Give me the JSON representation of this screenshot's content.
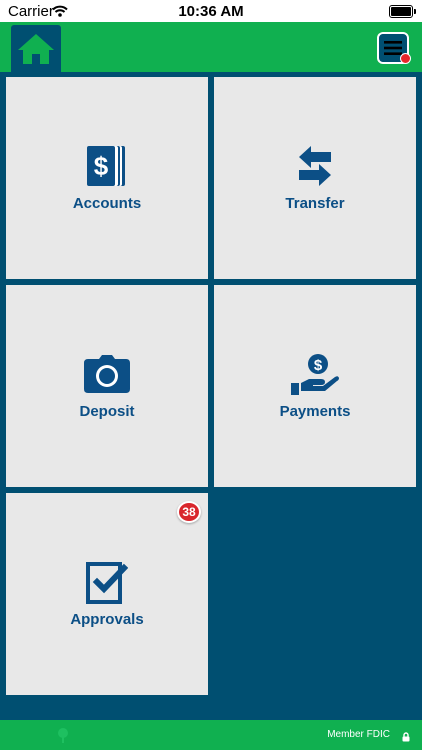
{
  "status_bar": {
    "carrier": "Carrier",
    "time": "10:36 AM"
  },
  "header": {
    "home_icon": "home-icon",
    "menu_icon": "hamburger-menu-icon"
  },
  "tiles": [
    {
      "label": "Accounts",
      "icon": "dollar-cards-icon"
    },
    {
      "label": "Transfer",
      "icon": "transfer-arrows-icon"
    },
    {
      "label": "Deposit",
      "icon": "camera-icon"
    },
    {
      "label": "Payments",
      "icon": "hand-dollar-icon"
    },
    {
      "label": "Approvals",
      "icon": "checkbox-icon",
      "badge": "38"
    }
  ],
  "footer": {
    "text": "Member FDIC",
    "lock_icon": "lock-icon"
  },
  "colors": {
    "navy": "#004f71",
    "green": "#10b050",
    "tile": "#e8e8e8",
    "label": "#0c4f86",
    "badge": "#d9262c"
  }
}
